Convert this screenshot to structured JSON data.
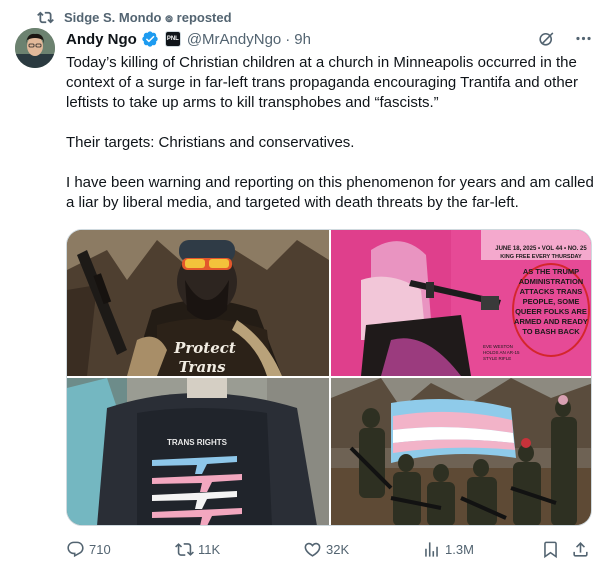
{
  "repost": {
    "text": "Sidge S. Mondo ๏ reposted",
    "icon": "repost-icon"
  },
  "author": {
    "name": "Andy Ngo",
    "handle": "@MrAndyNgo",
    "separator": "·",
    "time": "9h",
    "affiliate_badge": "PNL",
    "verified_color": "#1d9bf0"
  },
  "tweet": {
    "paragraphs": [
      "Today’s killing of Christian children at a church in Minneapolis occurred in the context of a surge in far-left trans propaganda encouraging Trantifa and other leftists to take up arms to kill transphobes and “fascists.”",
      "Their targets: Christians and conservatives.",
      "I have been warning and reporting on this phenomenon for years and am called a liar by liberal media, and targeted with death threats by the far-left."
    ]
  },
  "media": {
    "image1": {
      "shirt_line1": "Protect",
      "shirt_line2": "Trans"
    },
    "image2": {
      "mag_header": "JUNE 18, 2025 • VOL 44 • NO. 25",
      "mag_sub": "KING FREE EVERY THURSDAY",
      "circled": [
        "AS THE TRUMP",
        "ADMINISTRATION",
        "ATTACKS TRANS",
        "PEOPLE, SOME",
        "QUEER FOLKS ARE",
        "ARMED AND READY",
        "TO BASH BACK"
      ],
      "caption": [
        "EVE WESTON",
        "HOLDS AN AR-15",
        "STYLE RIFLE"
      ]
    },
    "image3": {
      "shirt_text": "TRANS RIGHTS"
    },
    "image4": {}
  },
  "actions": {
    "replies": "710",
    "reposts": "11K",
    "likes": "32K",
    "views": "1.3M"
  },
  "colors": {
    "text_primary": "#0f1419",
    "text_secondary": "#536471",
    "accent": "#1d9bf0",
    "border": "#cfd9de",
    "circle_red": "#d4262c"
  }
}
